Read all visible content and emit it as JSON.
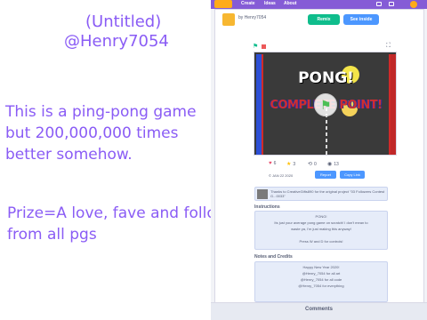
{
  "overlay": {
    "title": "(Untitled)",
    "username": "@Henry7054",
    "description": "This is a ping-pong game but 200,000,000 times better somehow.",
    "prize": "Prize=A love, fave and follow from all pgs"
  },
  "navbar": {
    "items": [
      "Create",
      "Ideas",
      "About"
    ]
  },
  "project": {
    "author": "by Henry7054",
    "remix_label": "Remix",
    "see_inside_label": "See inside",
    "stage": {
      "logo_text": "PONG!",
      "overlay_text": "COMPLETE POINT!"
    },
    "stats": {
      "loves": "6",
      "faves": "3",
      "remixes": "0",
      "views": "13"
    },
    "date": "© JAN 22 2020",
    "report_label": "Report",
    "copy_link_label": "Copy Link",
    "remix_credit": "Thanks to CreativeGifts890 for the original project \"03 Followers Contest G...0033\"",
    "instructions_title": "Instructions",
    "instructions_lines": [
      "PONG!",
      "Its just your average pong game on scratch! I don't mean to",
      "waste ya, I'm just making this anyway!",
      "",
      "Press W and D for controls!"
    ],
    "notes_title": "Notes and Credits",
    "notes_lines": [
      "Happy New Year 2020!",
      "@Henry_7054 for all art",
      "@Henry_7054 for all code",
      "@Henry_7054 for everything"
    ],
    "comments_label": "Comments"
  },
  "colors": {
    "overlay_text": "#8a5cf5",
    "navbar": "#855cd6",
    "remix": "#0fbd8c",
    "see_inside": "#4c97ff"
  },
  "icons": {
    "flag": "green-flag-icon",
    "stop": "stop-icon",
    "fullscreen": "fullscreen-icon",
    "love": "heart-icon",
    "fave": "star-icon",
    "remix": "remix-icon",
    "views": "eye-icon"
  }
}
